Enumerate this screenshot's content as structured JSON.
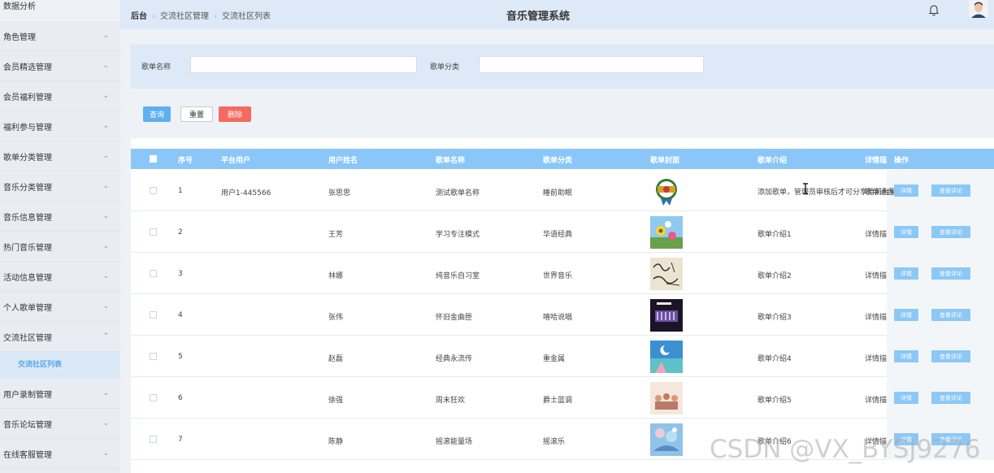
{
  "sidebar": {
    "top_item": "数据分析",
    "items": [
      {
        "label": "角色管理"
      },
      {
        "label": "会员精选管理"
      },
      {
        "label": "会员福利管理"
      },
      {
        "label": "福利参与管理"
      },
      {
        "label": "歌单分类管理"
      },
      {
        "label": "音乐分类管理"
      },
      {
        "label": "音乐信息管理"
      },
      {
        "label": "热门音乐管理"
      },
      {
        "label": "活动信息管理"
      },
      {
        "label": "个人歌单管理"
      },
      {
        "label": "交流社区管理"
      },
      {
        "label": "用户录制管理"
      },
      {
        "label": "音乐论坛管理"
      },
      {
        "label": "在线客服管理"
      }
    ],
    "active_sub": "交流社区列表"
  },
  "header": {
    "breadcrumb": [
      "后台",
      "交流社区管理",
      "交流社区列表"
    ],
    "title": "音乐管理系统"
  },
  "search": {
    "name_label": "歌单名称",
    "category_label": "歌单分类",
    "name_value": "",
    "category_value": ""
  },
  "buttons": {
    "query": "查询",
    "reset": "重置",
    "delete": "删除"
  },
  "table": {
    "columns": [
      "序号",
      "平台用户",
      "用户姓名",
      "歌单名称",
      "歌单分类",
      "歌单封面",
      "歌单介绍",
      "详情描",
      "操作"
    ],
    "detail_btn": "详情",
    "comment_btn": "查看评论",
    "rows": [
      {
        "index": "1",
        "platform_user": "用户1-445566",
        "user_name": "张思思",
        "playlist_name": "测试歌单名称",
        "category": "睡前助眠",
        "cover": "badge",
        "intro": "添加歌单，管理员审核后才可分享给前台展示",
        "detail": "歌单通台"
      },
      {
        "index": "2",
        "platform_user": "",
        "user_name": "王芳",
        "playlist_name": "学习专注模式",
        "category": "华语经典",
        "cover": "flowers",
        "intro": "歌单介绍1",
        "detail": "详情描"
      },
      {
        "index": "3",
        "platform_user": "",
        "user_name": "林娜",
        "playlist_name": "纯音乐自习室",
        "category": "世界音乐",
        "cover": "script",
        "intro": "歌单介绍2",
        "detail": "详情描"
      },
      {
        "index": "4",
        "platform_user": "",
        "user_name": "张伟",
        "playlist_name": "怀旧金曲匣",
        "category": "嘻哈说唱",
        "cover": "dark",
        "intro": "歌单介绍3",
        "detail": "详情描"
      },
      {
        "index": "5",
        "platform_user": "",
        "user_name": "赵磊",
        "playlist_name": "经典永流传",
        "category": "重金属",
        "cover": "moon",
        "intro": "歌单介绍4",
        "detail": "详情描"
      },
      {
        "index": "6",
        "platform_user": "",
        "user_name": "徐强",
        "playlist_name": "周末狂欢",
        "category": "爵士蓝调",
        "cover": "people",
        "intro": "歌单介绍5",
        "detail": "详情描"
      },
      {
        "index": "7",
        "platform_user": "",
        "user_name": "陈静",
        "playlist_name": "摇滚能量场",
        "category": "摇滚乐",
        "cover": "sky",
        "intro": "歌单介绍6",
        "detail": "详情描"
      }
    ]
  },
  "watermark": "CSDN @VX_BYSJ9276",
  "colors": {
    "accent": "#5fb0f0",
    "table_header": "#8ac7f8",
    "delete": "#f46a60",
    "sidebar_active": "#5aa6e6"
  }
}
